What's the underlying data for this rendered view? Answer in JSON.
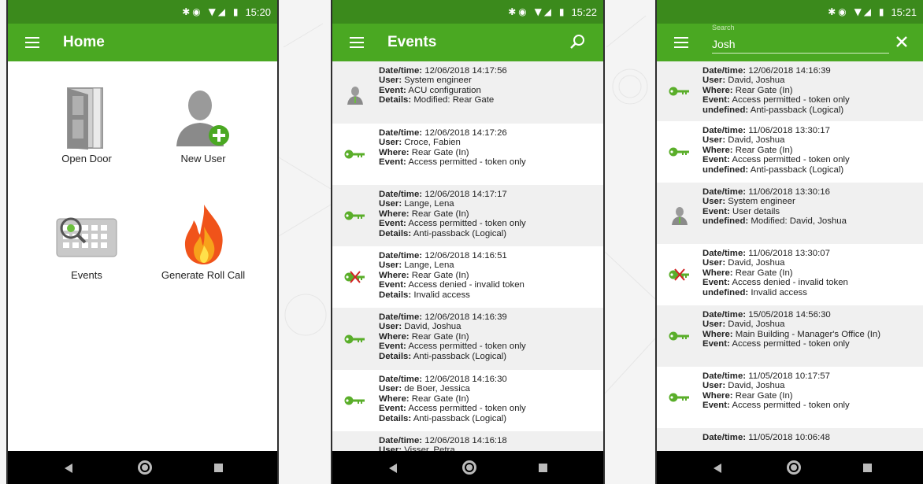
{
  "screens": [
    {
      "status_time": "15:20",
      "title": "Home",
      "tiles": [
        {
          "label": "Open Door",
          "icon": "door-icon"
        },
        {
          "label": "New User",
          "icon": "add-user-icon"
        },
        {
          "label": "Events",
          "icon": "events-icon"
        },
        {
          "label": "Generate Roll Call",
          "icon": "fire-icon"
        }
      ]
    },
    {
      "status_time": "15:22",
      "title": "Events",
      "events": [
        {
          "icon": "user-icon",
          "lines": [
            [
              "Date/time:",
              "12/06/2018 14:17:56"
            ],
            [
              "User:",
              "System engineer"
            ],
            [
              "Event:",
              "ACU configuration"
            ],
            [
              "Details:",
              "Modified: Rear Gate"
            ]
          ]
        },
        {
          "icon": "key-icon",
          "lines": [
            [
              "Date/time:",
              "12/06/2018 14:17:26"
            ],
            [
              "User:",
              "Croce, Fabien"
            ],
            [
              "Where:",
              "Rear Gate (In)"
            ],
            [
              "Event:",
              "Access permitted - token only"
            ]
          ]
        },
        {
          "icon": "key-icon",
          "lines": [
            [
              "Date/time:",
              "12/06/2018 14:17:17"
            ],
            [
              "User:",
              "Lange, Lena"
            ],
            [
              "Where:",
              "Rear Gate (In)"
            ],
            [
              "Event:",
              "Access permitted - token only"
            ],
            [
              "Details:",
              "Anti-passback (Logical)"
            ]
          ]
        },
        {
          "icon": "key-denied-icon",
          "lines": [
            [
              "Date/time:",
              "12/06/2018 14:16:51"
            ],
            [
              "User:",
              "Lange, Lena"
            ],
            [
              "Where:",
              "Rear Gate (In)"
            ],
            [
              "Event:",
              "Access denied - invalid token"
            ],
            [
              "Details:",
              "Invalid access"
            ]
          ]
        },
        {
          "icon": "key-icon",
          "lines": [
            [
              "Date/time:",
              "12/06/2018 14:16:39"
            ],
            [
              "User:",
              "David, Joshua"
            ],
            [
              "Where:",
              "Rear Gate (In)"
            ],
            [
              "Event:",
              "Access permitted - token only"
            ],
            [
              "Details:",
              "Anti-passback (Logical)"
            ]
          ]
        },
        {
          "icon": "key-icon",
          "lines": [
            [
              "Date/time:",
              "12/06/2018 14:16:30"
            ],
            [
              "User:",
              "de Boer, Jessica"
            ],
            [
              "Where:",
              "Rear Gate (In)"
            ],
            [
              "Event:",
              "Access permitted - token only"
            ],
            [
              "Details:",
              "Anti-passback (Logical)"
            ]
          ]
        },
        {
          "icon": "",
          "lines": [
            [
              "Date/time:",
              "12/06/2018 14:16:18"
            ],
            [
              "User:",
              "Visser, Petra"
            ]
          ]
        }
      ]
    },
    {
      "status_time": "15:21",
      "search_hint": "Search",
      "search_value": "Josh",
      "events": [
        {
          "icon": "key-icon",
          "lines": [
            [
              "Date/time:",
              "12/06/2018 14:16:39"
            ],
            [
              "User:",
              "David, Joshua"
            ],
            [
              "Where:",
              "Rear Gate (In)"
            ],
            [
              "Event:",
              "Access permitted - token only"
            ],
            [
              "undefined:",
              "Anti-passback (Logical)"
            ]
          ]
        },
        {
          "icon": "key-icon",
          "lines": [
            [
              "Date/time:",
              "11/06/2018 13:30:17"
            ],
            [
              "User:",
              "David, Joshua"
            ],
            [
              "Where:",
              "Rear Gate (In)"
            ],
            [
              "Event:",
              "Access permitted - token only"
            ],
            [
              "undefined:",
              "Anti-passback (Logical)"
            ]
          ]
        },
        {
          "icon": "user-icon",
          "lines": [
            [
              "Date/time:",
              "11/06/2018 13:30:16"
            ],
            [
              "User:",
              "System engineer"
            ],
            [
              "Event:",
              "User details"
            ],
            [
              "undefined:",
              "Modified: David, Joshua"
            ]
          ]
        },
        {
          "icon": "key-denied-icon",
          "lines": [
            [
              "Date/time:",
              "11/06/2018 13:30:07"
            ],
            [
              "User:",
              "David, Joshua"
            ],
            [
              "Where:",
              "Rear Gate (In)"
            ],
            [
              "Event:",
              "Access denied - invalid token"
            ],
            [
              "undefined:",
              "Invalid access"
            ]
          ]
        },
        {
          "icon": "key-icon",
          "lines": [
            [
              "Date/time:",
              "15/05/2018 14:56:30"
            ],
            [
              "User:",
              "David, Joshua"
            ],
            [
              "Where:",
              "Main Building - Manager's Office (In)"
            ],
            [
              "Event:",
              "Access permitted - token only"
            ]
          ]
        },
        {
          "icon": "key-icon",
          "lines": [
            [
              "Date/time:",
              "11/05/2018 10:17:57"
            ],
            [
              "User:",
              "David, Joshua"
            ],
            [
              "Where:",
              "Rear Gate (In)"
            ],
            [
              "Event:",
              "Access permitted - token only"
            ]
          ]
        },
        {
          "icon": "",
          "lines": [
            [
              "Date/time:",
              "11/05/2018 10:06:48"
            ]
          ]
        }
      ]
    }
  ],
  "colors": {
    "appbar": "#4aa822",
    "statusbar": "#3b8a1c",
    "key": "#5aae2a",
    "denied": "#d22222"
  }
}
